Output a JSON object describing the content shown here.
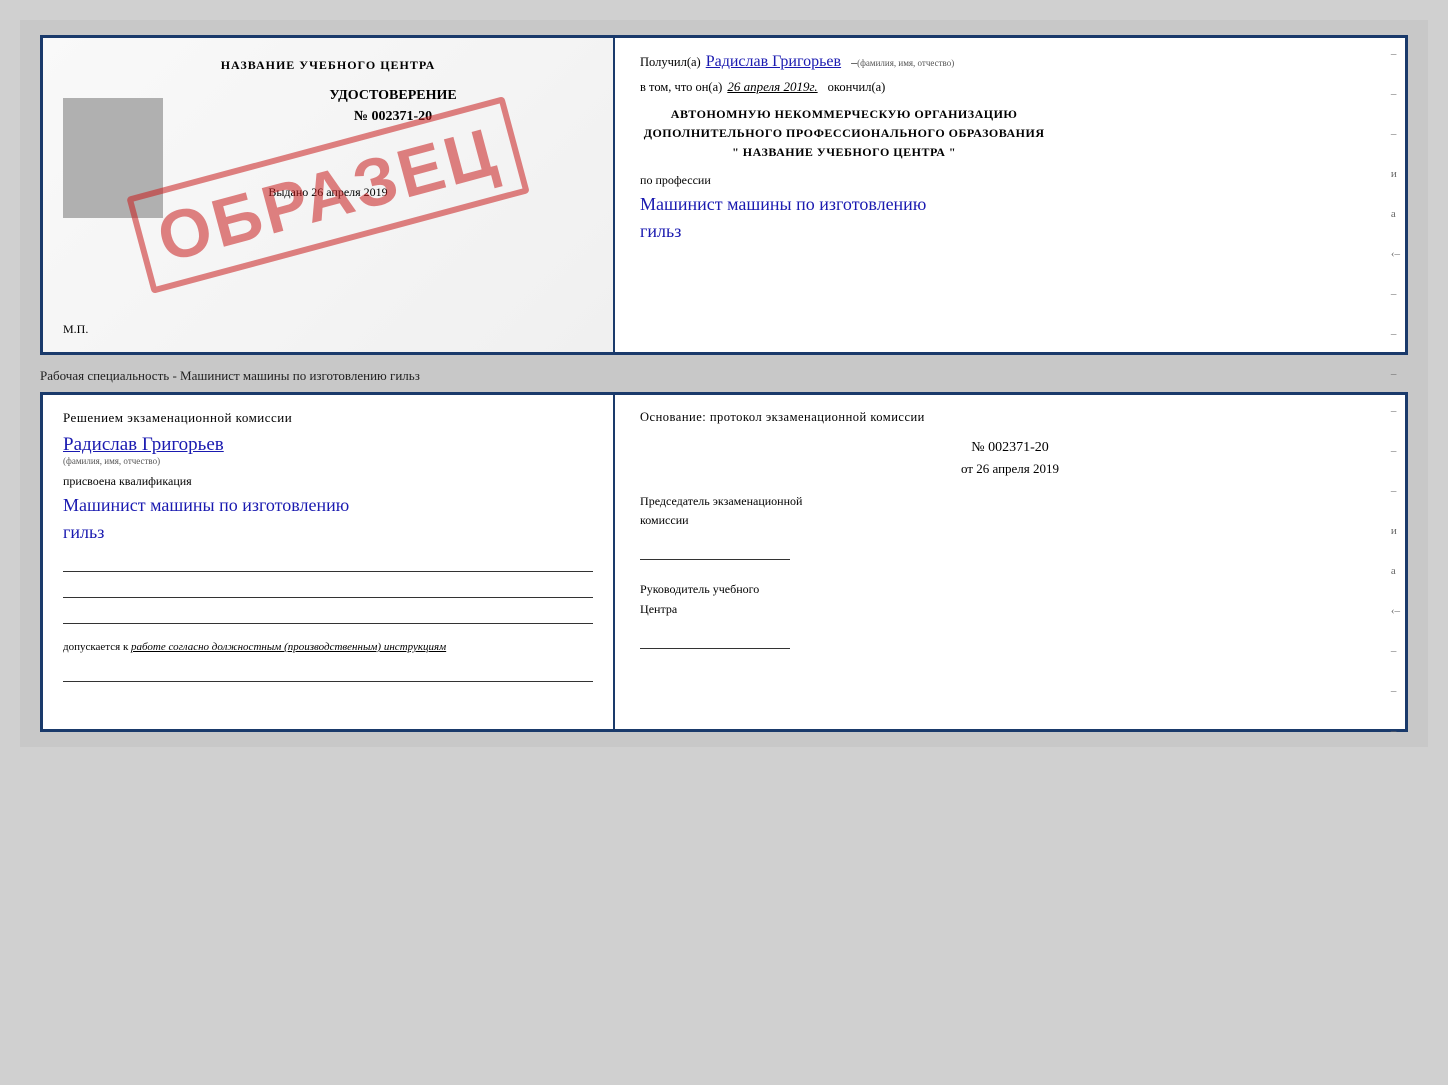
{
  "top_doc": {
    "left": {
      "title": "НАЗВАНИЕ УЧЕБНОГО ЦЕНТРА",
      "udostoverenie": "УДОСТОВЕРЕНИЕ",
      "number": "№ 002371-20",
      "vydano_label": "Выдано",
      "vydano_date": "26 апреля 2019",
      "mp": "М.П.",
      "stamp": "ОБРАЗЕЦ"
    },
    "right": {
      "poluchil_label": "Получил(а)",
      "poluchil_name": "Радислав Григорьев",
      "poluchil_sub": "(фамилия, имя, отчество)",
      "vtom_label": "в том, что он(а)",
      "vtom_date": "26 апреля 2019г.",
      "okochil_label": "окончил(а)",
      "org_line1": "АВТОНОМНУЮ НЕКОММЕРЧЕСКУЮ ОРГАНИЗАЦИЮ",
      "org_line2": "ДОПОЛНИТЕЛЬНОГО ПРОФЕССИОНАЛЬНОГО ОБРАЗОВАНИЯ",
      "org_line3": "\"   НАЗВАНИЕ УЧЕБНОГО ЦЕНТРА   \"",
      "po_professii": "по профессии",
      "profession_line1": "Машинист машины по изготовлению",
      "profession_line2": "гильз",
      "side_marks": [
        "–",
        "–",
        "–",
        "и",
        "а",
        "‹–",
        "–",
        "–",
        "–"
      ]
    }
  },
  "separator": {
    "text": "Рабочая специальность - Машинист машины по изготовлению гильз"
  },
  "bottom_doc": {
    "left": {
      "resheniem": "Решением  экзаменационной  комиссии",
      "name": "Радислав Григорьев",
      "name_sub": "(фамилия, имя, отчество)",
      "prisvoena": "присвоена квалификация",
      "qual_line1": "Машинист машины по изготовлению",
      "qual_line2": "гильз",
      "dopusk_label": "допускается к",
      "dopusk_text": "работе согласно должностным (производственным) инструкциям"
    },
    "right": {
      "osnovanie": "Основание: протокол экзаменационной  комиссии",
      "number": "№  002371-20",
      "ot_label": "от",
      "ot_date": "26 апреля 2019",
      "predsedatel_line1": "Председатель экзаменационной",
      "predsedatel_line2": "комиссии",
      "rukovoditel_line1": "Руководитель учебного",
      "rukovoditel_line2": "Центра",
      "side_marks": [
        "–",
        "–",
        "–",
        "и",
        "а",
        "‹–",
        "–",
        "–",
        "–"
      ]
    }
  }
}
